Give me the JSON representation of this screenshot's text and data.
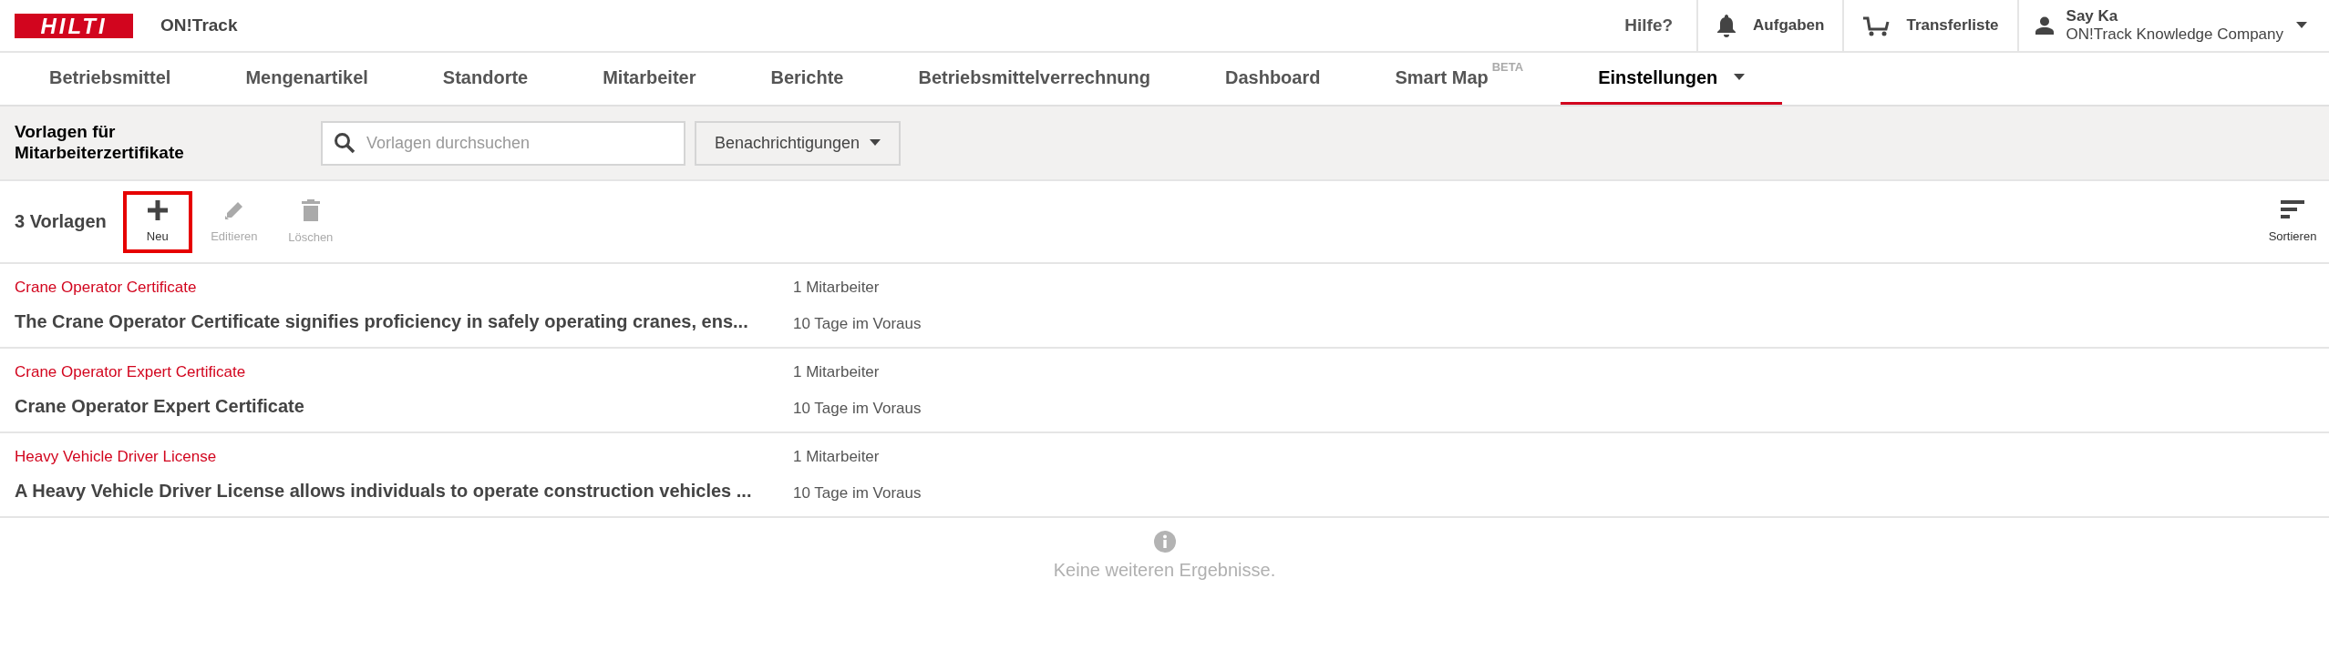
{
  "header": {
    "logo": "HILTI",
    "app_name": "ON!Track",
    "help": "Hilfe?",
    "tasks": "Aufgaben",
    "transfer": "Transferliste",
    "user": {
      "name": "Say Ka",
      "company": "ON!Track Knowledge Company"
    }
  },
  "nav": [
    {
      "label": "Betriebsmittel",
      "selected": false
    },
    {
      "label": "Mengenartikel",
      "selected": false
    },
    {
      "label": "Standorte",
      "selected": false
    },
    {
      "label": "Mitarbeiter",
      "selected": false
    },
    {
      "label": "Berichte",
      "selected": false
    },
    {
      "label": "Betriebsmittelverrechnung",
      "selected": false
    },
    {
      "label": "Dashboard",
      "selected": false
    },
    {
      "label": "Smart Map",
      "badge": "BETA",
      "selected": false
    },
    {
      "label": "Einstellungen",
      "dropdown": true,
      "selected": true
    }
  ],
  "subheader": {
    "title": "Vorlagen für Mitarbeiterzertifikate",
    "search": {
      "placeholder": "Vorlagen durchsuchen"
    },
    "dropdown": "Benachrichtigungen"
  },
  "toolbar": {
    "count": "3 Vorlagen",
    "actions": [
      {
        "kind": "add",
        "label": "Neu",
        "disabled": false,
        "highlighted": true
      },
      {
        "kind": "edit",
        "label": "Editieren",
        "disabled": true,
        "highlighted": false
      },
      {
        "kind": "delete",
        "label": "Löschen",
        "disabled": true,
        "highlighted": false
      }
    ],
    "sort": "Sortieren"
  },
  "templates": [
    {
      "name": "Crane Operator Certificate",
      "description": "The Crane Operator Certificate signifies proficiency in safely operating cranes, ens...",
      "employees": "1 Mitarbeiter",
      "advance": "10 Tage im Voraus"
    },
    {
      "name": "Crane Operator Expert Certificate",
      "description": "Crane Operator Expert Certificate",
      "employees": "1 Mitarbeiter",
      "advance": "10 Tage im Voraus"
    },
    {
      "name": "Heavy Vehicle Driver License",
      "description": "A Heavy Vehicle Driver License allows individuals to operate construction vehicles ...",
      "employees": "1 Mitarbeiter",
      "advance": "10 Tage im Voraus"
    }
  ],
  "end_message": "Keine weiteren Ergebnisse."
}
